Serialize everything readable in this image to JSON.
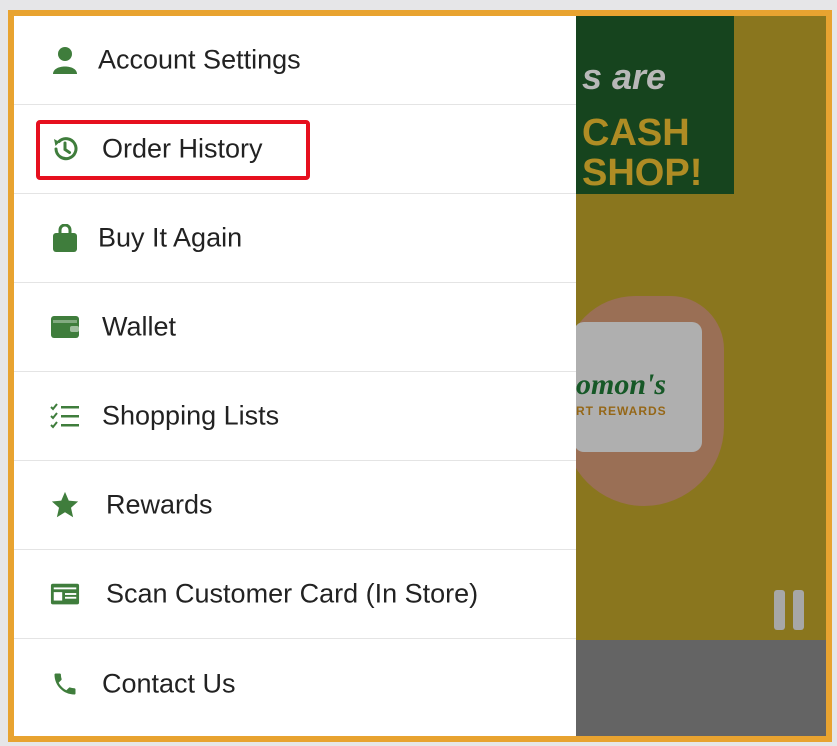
{
  "menu": {
    "items": [
      {
        "label": "Account Settings",
        "icon": "person-icon"
      },
      {
        "label": "Order History",
        "icon": "history-icon"
      },
      {
        "label": "Buy It Again",
        "icon": "shopping-bag-icon"
      },
      {
        "label": "Wallet",
        "icon": "wallet-icon"
      },
      {
        "label": "Shopping Lists",
        "icon": "checklist-icon"
      },
      {
        "label": "Rewards",
        "icon": "star-icon"
      },
      {
        "label": "Scan Customer Card (In Store)",
        "icon": "id-card-icon"
      },
      {
        "label": "Contact Us",
        "icon": "phone-icon"
      }
    ],
    "highlighted_item": "Order History"
  },
  "background_banner": {
    "promo_line_1": "s are",
    "promo_line_2": "CASH",
    "promo_line_3": "SHOP!",
    "brand_text": "omon's",
    "brand_subtext": "RT REWARDS"
  },
  "colors": {
    "accent_green": "#3f7d3c",
    "frame_border": "#e8a330",
    "highlight_red": "#e60f1e"
  }
}
